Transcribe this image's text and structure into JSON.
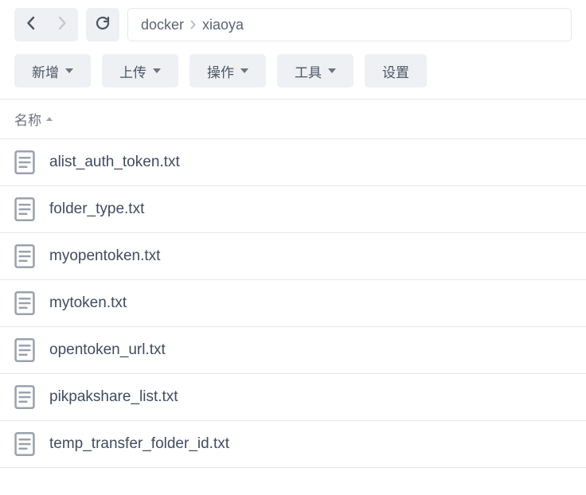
{
  "breadcrumb": {
    "items": [
      "docker",
      "xiaoya"
    ]
  },
  "toolbar": {
    "new_label": "新增",
    "upload_label": "上传",
    "action_label": "操作",
    "tools_label": "工具",
    "settings_label": "设置"
  },
  "header": {
    "name_label": "名称"
  },
  "files": [
    {
      "name": "alist_auth_token.txt"
    },
    {
      "name": "folder_type.txt"
    },
    {
      "name": "myopentoken.txt"
    },
    {
      "name": "mytoken.txt"
    },
    {
      "name": "opentoken_url.txt"
    },
    {
      "name": "pikpakshare_list.txt"
    },
    {
      "name": "temp_transfer_folder_id.txt"
    }
  ]
}
